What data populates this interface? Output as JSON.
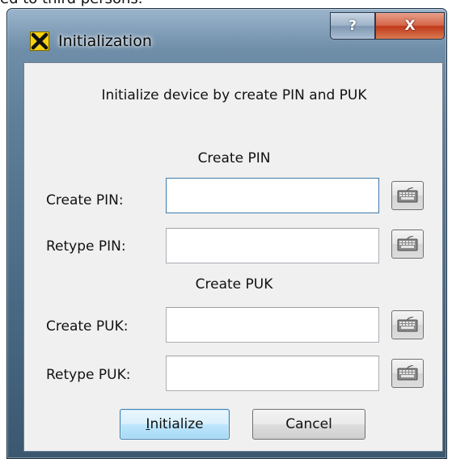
{
  "background": {
    "partial_text": "ed to third persons."
  },
  "window": {
    "title": "Initialization",
    "app_icon": "yellow-x-logo-icon",
    "help_button_label": "?",
    "close_button_label": "X"
  },
  "dialog": {
    "instruction": "Initialize device by create PIN and PUK",
    "pin_section": {
      "heading": "Create PIN",
      "create_label": "Create PIN:",
      "create_value": "",
      "retype_label": "Retype PIN:",
      "retype_value": ""
    },
    "puk_section": {
      "heading": "Create PUK",
      "create_label": "Create PUK:",
      "create_value": "",
      "retype_label": "Retype PUK:",
      "retype_value": ""
    },
    "keyboard_button_icon": "virtual-keyboard-icon",
    "buttons": {
      "initialize": {
        "label": "Initialize",
        "mnemonic": "I"
      },
      "cancel": "Cancel"
    }
  },
  "colors": {
    "title_bar": "#6f8ea9",
    "close_button": "#c0391a",
    "dialog_face": "#f0f0f0",
    "default_button": "#bee6fd"
  }
}
